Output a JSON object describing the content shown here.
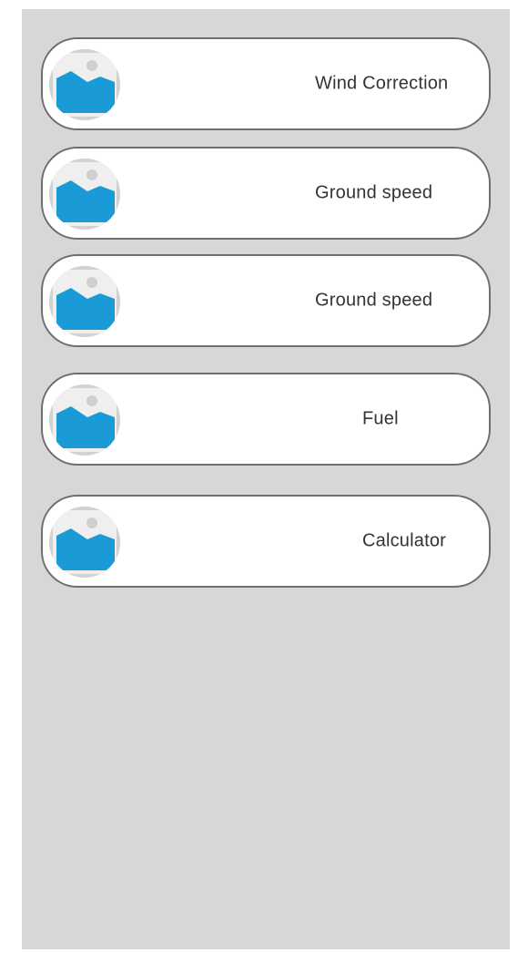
{
  "menu": {
    "items": [
      {
        "label": "Wind Correction",
        "icon": "image-placeholder-icon"
      },
      {
        "label": "Ground speed",
        "icon": "image-placeholder-icon"
      },
      {
        "label": "Ground speed",
        "icon": "image-placeholder-icon"
      },
      {
        "label": "Fuel",
        "icon": "image-placeholder-icon"
      },
      {
        "label": "Calculator",
        "icon": "image-placeholder-icon"
      }
    ]
  },
  "colors": {
    "panel_background": "#d7d7d7",
    "card_background": "#ffffff",
    "card_border": "#6f6f6f",
    "icon_blue": "#1a9ad7",
    "icon_gray": "#cfcfcf",
    "label_text": "#333333"
  }
}
